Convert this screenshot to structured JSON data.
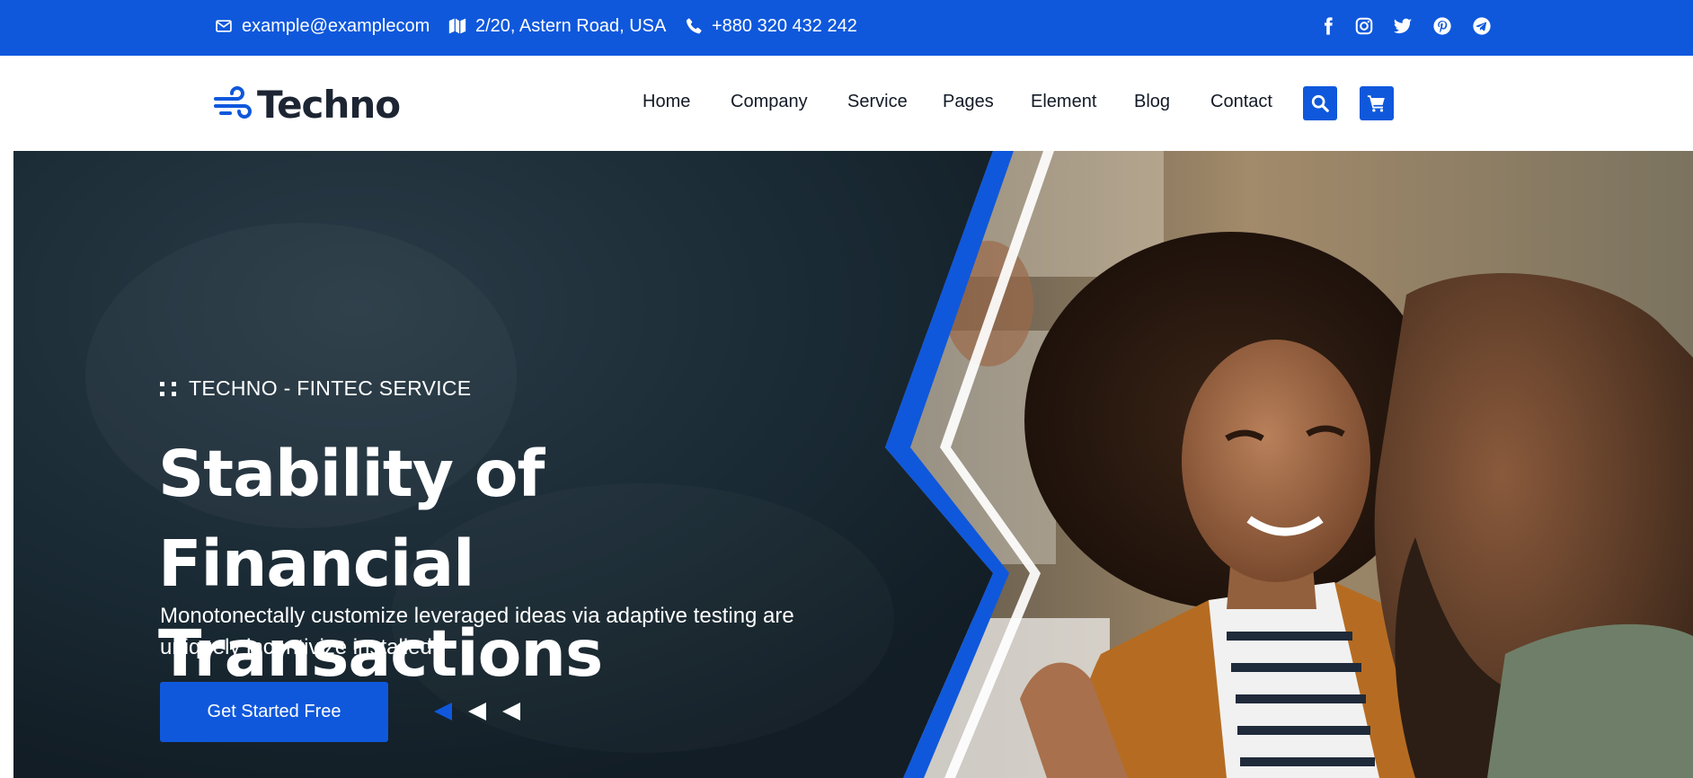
{
  "topbar": {
    "email": "example@examplecom",
    "address": "2/20, Astern Road, USA",
    "phone": "+880 320 432 242",
    "social_icons": [
      "facebook-icon",
      "instagram-icon",
      "twitter-icon",
      "pinterest-icon",
      "telegram-icon"
    ]
  },
  "header": {
    "logo_text": "Techno",
    "nav": [
      "Home",
      "Company",
      "Service",
      "Pages",
      "Element",
      "Blog",
      "Contact"
    ],
    "action_icons": [
      "search-icon",
      "cart-icon"
    ]
  },
  "hero": {
    "subtitle": "TECHNO - FINTEC SERVICE",
    "headline_line1": "Stability of Financial",
    "headline_line2": "Transactions",
    "lead_line1": "Monotonectally customize leveraged ideas via adaptive testing are",
    "lead_line2": "uniquely incentivize installed",
    "cta_label": "Get Started Free",
    "slider_arrows": 3,
    "active_arrow": 1
  },
  "colors": {
    "brand_blue": "#0f58dc",
    "hero_dark": "#16242e",
    "nav_text": "#121a26",
    "logo_text": "#1d2533"
  }
}
